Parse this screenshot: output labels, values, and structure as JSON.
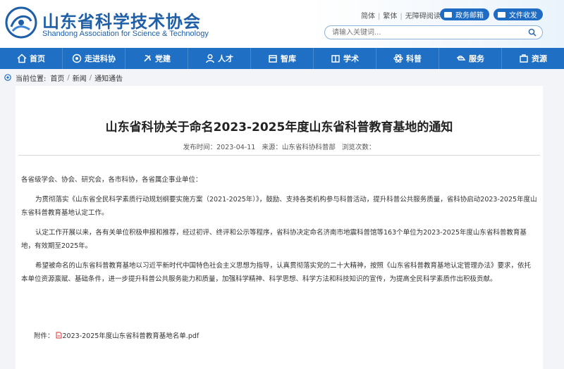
{
  "header": {
    "org_name_cn": "山东省科学技术协会",
    "org_name_en": "Shandong Association for Science & Technology",
    "links": [
      "简体",
      "繁体",
      "无障碍阅读"
    ],
    "mail_button": "政务邮箱",
    "docs_button": "文件收发",
    "search_placeholder": "请输入关键词...",
    "colors": {
      "brand": "#1e5fa8",
      "nav": "#1f6fc5"
    }
  },
  "nav": {
    "items": [
      {
        "label": "首页",
        "icon": "home-icon"
      },
      {
        "label": "走进科协",
        "icon": "emblem-icon"
      },
      {
        "label": "党建",
        "icon": "party-icon"
      },
      {
        "label": "人才",
        "icon": "person-icon"
      },
      {
        "label": "智库",
        "icon": "think-tank-icon"
      },
      {
        "label": "学术",
        "icon": "academic-icon"
      },
      {
        "label": "科普",
        "icon": "atom-icon"
      },
      {
        "label": "服务",
        "icon": "service-icon"
      },
      {
        "label": "资源",
        "icon": "resource-icon"
      }
    ]
  },
  "breadcrumb": {
    "prefix": "当前位置:",
    "items": [
      "首页",
      "新闻",
      "通知通告"
    ]
  },
  "article": {
    "title": "山东省科协关于命名2023-2025年度山东省科普教育基地的通知",
    "publish_time": "发布时间：2023-04-11",
    "source": "来源：山东省科协科普部",
    "views": "浏览次数：",
    "salutation": "各省级学会、协会、研究会，各市科协，各省属企事业单位：",
    "paragraphs": [
      "为贯彻落实《山东省全民科学素质行动规划纲要实施方案（2021-2025年）》，鼓励、支持各类机构参与科普活动，提升科普公共服务质量，省科协启动2023-2025年度山东省科普教育基地认定工作。",
      "认定工作开展以来，各有关单位积极申报和推荐，经过初评、终评和公示等程序，省科协决定命名济南市地震科普馆等163个单位为2023-2025年度山东省科普教育基地，有效期至2025年。",
      "希望被命名的山东省科普教育基地以习近平新时代中国特色社会主义思想为指导，认真贯彻落实党的二十大精神，按照《山东省科普教育基地认定管理办法》要求，依托本单位资源禀赋、基础条件，进一步提升科普公共服务能力和质量，加强科学精神、科学思想、科学方法和科技知识的宣传，为提高全民科学素质作出积极贡献。"
    ],
    "attachment_label": "附件：",
    "attachment_file": "2023-2025年度山东省科普教育基地名单.pdf"
  }
}
